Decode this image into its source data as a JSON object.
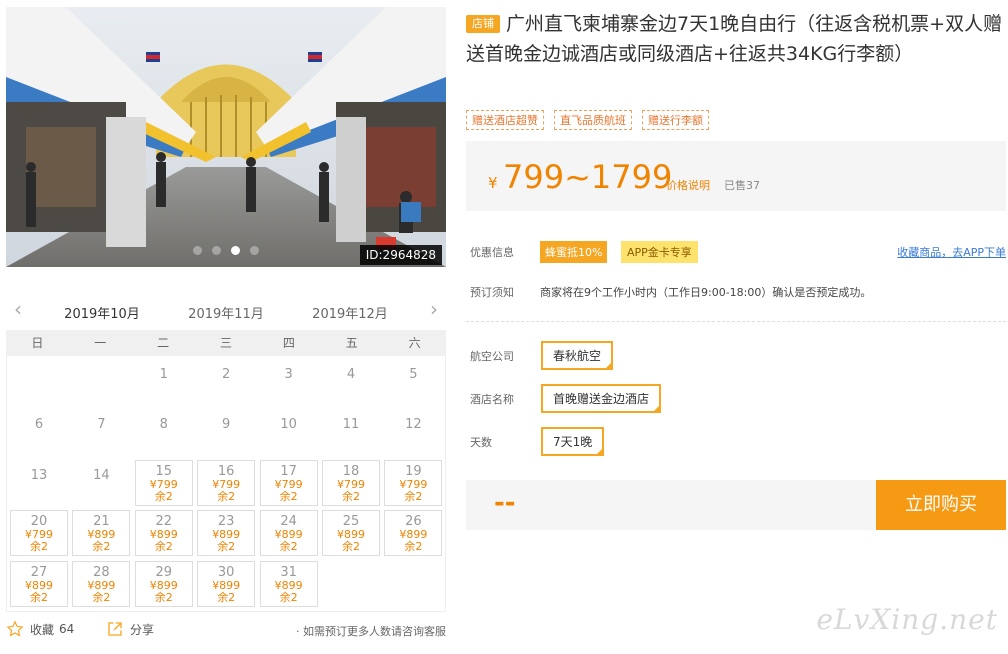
{
  "photo": {
    "image_id": "ID:2964828",
    "dot_count": 4,
    "active_dot": 2
  },
  "calendar": {
    "months": [
      "2019年10月",
      "2019年11月",
      "2019年12月"
    ],
    "active_month": 0,
    "weekdays": [
      "日",
      "一",
      "二",
      "三",
      "四",
      "五",
      "六"
    ],
    "days": [
      {
        "d": "1",
        "col": 2,
        "row": 0
      },
      {
        "d": "2",
        "col": 3,
        "row": 0
      },
      {
        "d": "3",
        "col": 4,
        "row": 0
      },
      {
        "d": "4",
        "col": 5,
        "row": 0
      },
      {
        "d": "5",
        "col": 6,
        "row": 0
      },
      {
        "d": "6",
        "col": 0,
        "row": 1
      },
      {
        "d": "7",
        "col": 1,
        "row": 1
      },
      {
        "d": "8",
        "col": 2,
        "row": 1
      },
      {
        "d": "9",
        "col": 3,
        "row": 1
      },
      {
        "d": "10",
        "col": 4,
        "row": 1
      },
      {
        "d": "11",
        "col": 5,
        "row": 1
      },
      {
        "d": "12",
        "col": 6,
        "row": 1
      },
      {
        "d": "13",
        "col": 0,
        "row": 2
      },
      {
        "d": "14",
        "col": 1,
        "row": 2
      },
      {
        "d": "15",
        "col": 2,
        "row": 2,
        "price": "¥799",
        "stock": "余2"
      },
      {
        "d": "16",
        "col": 3,
        "row": 2,
        "price": "¥799",
        "stock": "余2"
      },
      {
        "d": "17",
        "col": 4,
        "row": 2,
        "price": "¥799",
        "stock": "余2"
      },
      {
        "d": "18",
        "col": 5,
        "row": 2,
        "price": "¥799",
        "stock": "余2"
      },
      {
        "d": "19",
        "col": 6,
        "row": 2,
        "price": "¥799",
        "stock": "余2"
      },
      {
        "d": "20",
        "col": 0,
        "row": 3,
        "price": "¥799",
        "stock": "余2"
      },
      {
        "d": "21",
        "col": 1,
        "row": 3,
        "price": "¥899",
        "stock": "余2"
      },
      {
        "d": "22",
        "col": 2,
        "row": 3,
        "price": "¥899",
        "stock": "余2"
      },
      {
        "d": "23",
        "col": 3,
        "row": 3,
        "price": "¥899",
        "stock": "余2"
      },
      {
        "d": "24",
        "col": 4,
        "row": 3,
        "price": "¥899",
        "stock": "余2"
      },
      {
        "d": "25",
        "col": 5,
        "row": 3,
        "price": "¥899",
        "stock": "余2"
      },
      {
        "d": "26",
        "col": 6,
        "row": 3,
        "price": "¥899",
        "stock": "余2"
      },
      {
        "d": "27",
        "col": 0,
        "row": 4,
        "price": "¥899",
        "stock": "余2"
      },
      {
        "d": "28",
        "col": 1,
        "row": 4,
        "price": "¥899",
        "stock": "余2"
      },
      {
        "d": "29",
        "col": 2,
        "row": 4,
        "price": "¥899",
        "stock": "余2"
      },
      {
        "d": "30",
        "col": 3,
        "row": 4,
        "price": "¥899",
        "stock": "余2"
      },
      {
        "d": "31",
        "col": 4,
        "row": 4,
        "price": "¥899",
        "stock": "余2"
      }
    ]
  },
  "bottom": {
    "fav_label": "收藏",
    "fav_count": "64",
    "share_label": "分享",
    "consult": "· 如需预订更多人数请咨询客服"
  },
  "product": {
    "shop_badge": "店铺",
    "title": "广州直飞柬埔寨金边7天1晚自由行（往返含税机票+双人赠送首晚金边诚酒店或同级酒店+往返共34KG行李额）",
    "tags": [
      "赠送酒店超赞",
      "直飞品质航班",
      "赠送行李额"
    ]
  },
  "price": {
    "currency": "¥",
    "range": "799~1799",
    "explain": "价格说明",
    "sold": "已售37"
  },
  "promo": {
    "label": "优惠信息",
    "tag1": "蜂蜜抵10%",
    "tag2": "APP金卡专享",
    "app_link": "收藏商品，去APP下单"
  },
  "booking_notice": {
    "label": "预订须知",
    "text": "商家将在9个工作小时内（工作日9:00-18:00）确认是否预定成功。"
  },
  "options": {
    "airline_label": "航空公司",
    "airline": "春秋航空",
    "hotel_label": "酒店名称",
    "hotel": "首晚赠送金边酒店",
    "days_label": "天数",
    "days": "7天1晚"
  },
  "buy": {
    "total": "--",
    "button": "立即购买"
  },
  "watermark": "eLvXing.net",
  "colors": {
    "accent": "#f5a623",
    "price": "#f08300",
    "link": "#3a7bd5"
  }
}
